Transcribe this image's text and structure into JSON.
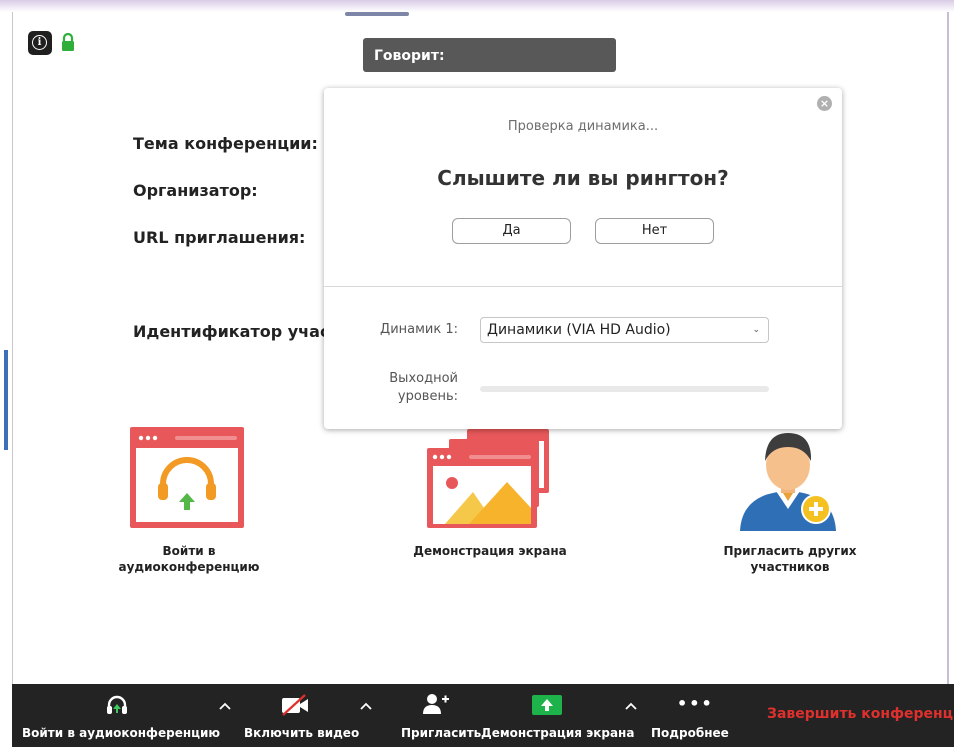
{
  "speaker_banner": {
    "label": "Говорит:"
  },
  "meeting_info": {
    "topic_label": "Тема конференции:",
    "host_label": "Организатор:",
    "invite_url_label": "URL приглашения:",
    "participant_id_label": "Идентификатор участника:"
  },
  "speaker_test_dialog": {
    "status": "Проверка динамика...",
    "question": "Слышите ли вы рингтон?",
    "yes_label": "Да",
    "no_label": "Нет",
    "speaker_label": "Динамик 1:",
    "speaker_value": "Динамики (VIA HD Audio)",
    "output_level_label": "Выходной уровень:",
    "output_level": 0
  },
  "actions": {
    "join_audio": "Войти в аудиоконференцию",
    "share_screen": "Демонстрация экрана",
    "invite_others": "Пригласить других участников"
  },
  "toolbar": {
    "join_audio": "Войти в аудиоконференцию",
    "start_video": "Включить видео",
    "invite": "Пригласить",
    "share_screen": "Демонстрация экрана",
    "more": "Подробнее",
    "end_meeting": "Завершить конференцию"
  },
  "colors": {
    "toolbar_bg": "#232323",
    "end_meeting": "#e0302d",
    "share_green": "#1db24a",
    "tile_red": "#e8585a",
    "headphones_orange": "#f29a24",
    "add_green": "#54b848"
  }
}
